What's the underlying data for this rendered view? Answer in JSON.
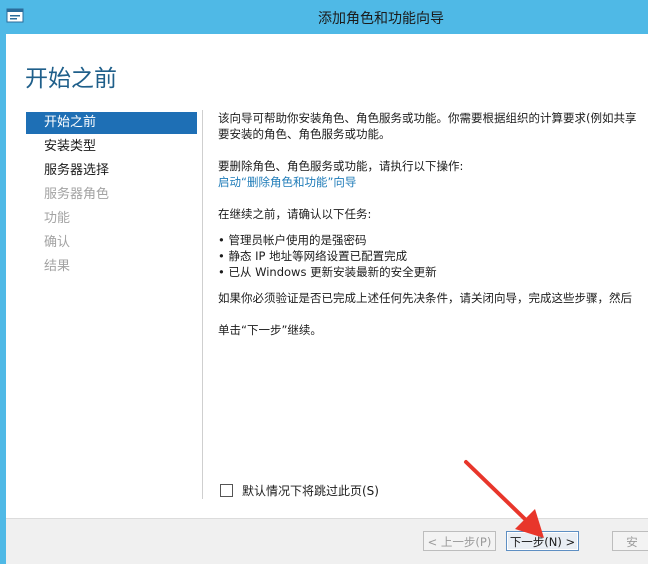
{
  "window": {
    "title": "添加角色和功能向导",
    "page_title": "开始之前"
  },
  "sidebar": {
    "items": [
      {
        "label": "开始之前",
        "state": "active"
      },
      {
        "label": "安装类型",
        "state": "enabled"
      },
      {
        "label": "服务器选择",
        "state": "enabled"
      },
      {
        "label": "服务器角色",
        "state": "disabled"
      },
      {
        "label": "功能",
        "state": "disabled"
      },
      {
        "label": "确认",
        "state": "disabled"
      },
      {
        "label": "结果",
        "state": "disabled"
      }
    ]
  },
  "content": {
    "intro_line1": "该向导可帮助你安装角色、角色服务或功能。你需要根据组织的计算要求(例如共享",
    "intro_line2": "要安装的角色、角色服务或功能。",
    "remove_prompt": "要删除角色、角色服务或功能，请执行以下操作:",
    "remove_link": "启动“删除角色和功能”向导",
    "continue_prompt": "在继续之前，请确认以下任务:",
    "tasks": [
      "管理员帐户使用的是强密码",
      "静态 IP 地址等网络设置已配置完成",
      "已从 Windows 更新安装最新的安全更新"
    ],
    "verify_note": "如果你必须验证是否已完成上述任何先决条件，请关闭向导，完成这些步骤，然后",
    "next_instruction": "单击“下一步”继续。"
  },
  "skip_checkbox": {
    "label": "默认情况下将跳过此页(S)",
    "checked": false
  },
  "footer": {
    "prev_label": "< 上一步(P)",
    "next_label": "下一步(N) >",
    "third_label": "安"
  },
  "colors": {
    "title_bar": "#4fb9e6",
    "accent": "#1e6fb5",
    "link": "#1e7bb8",
    "annotation_arrow": "#e8362b"
  }
}
